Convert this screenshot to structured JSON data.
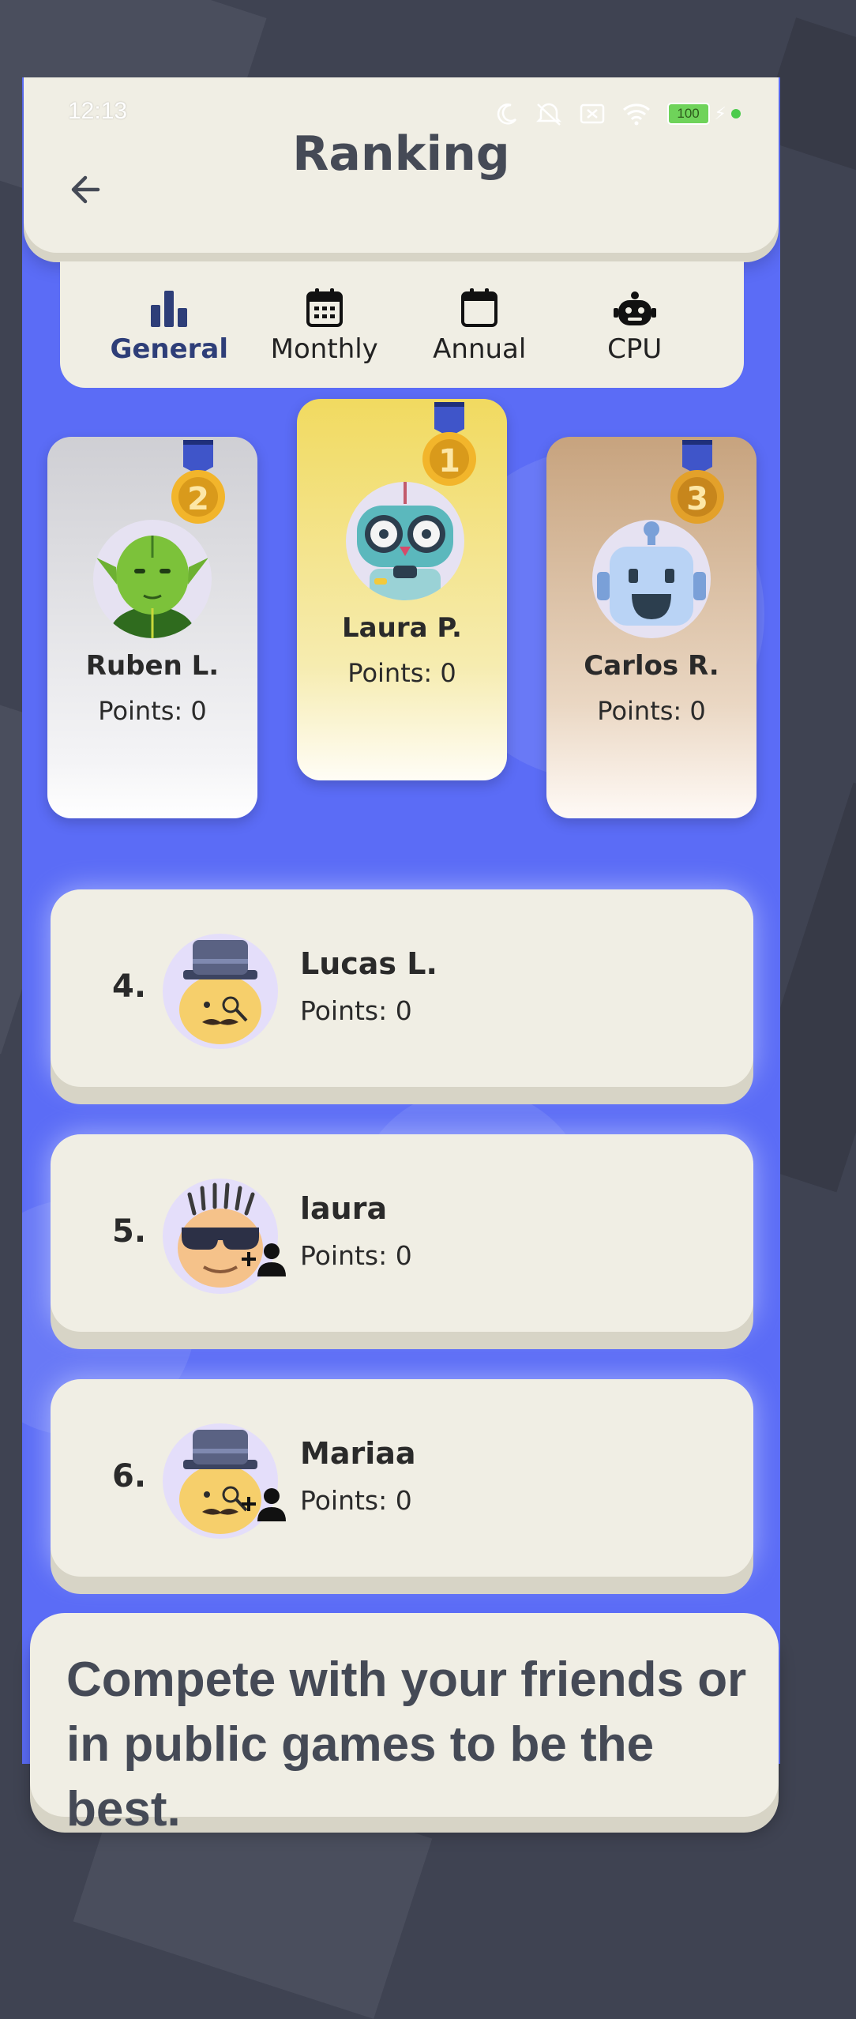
{
  "status_bar": {
    "time": "12:13",
    "battery": "100"
  },
  "header": {
    "title": "Ranking"
  },
  "tabs": [
    {
      "label": "General",
      "icon": "bar-chart-icon",
      "active": true
    },
    {
      "label": "Monthly",
      "icon": "calendar-grid-icon",
      "active": false
    },
    {
      "label": "Annual",
      "icon": "calendar-blank-icon",
      "active": false
    },
    {
      "label": "CPU",
      "icon": "robot-icon",
      "active": false
    }
  ],
  "podium": [
    {
      "place": "2",
      "name": "Ruben L.",
      "points": "Points: 0",
      "medal_color": "#f2b52b"
    },
    {
      "place": "1",
      "name": "Laura P.",
      "points": "Points: 0",
      "medal_color": "#f2b52b"
    },
    {
      "place": "3",
      "name": "Carlos R.",
      "points": "Points: 0",
      "medal_color": "#e3a12a"
    }
  ],
  "ranking": [
    {
      "rank": "4.",
      "name": "Lucas L.",
      "points": "Points: 0",
      "add_friend": false
    },
    {
      "rank": "5.",
      "name": "laura",
      "points": "Points: 0",
      "add_friend": true
    },
    {
      "rank": "6.",
      "name": "Mariaa",
      "points": "Points: 0",
      "add_friend": true
    }
  ],
  "banner": {
    "text": "Compete with your friends or in public games to be the best."
  },
  "colors": {
    "accent": "#5b6cf6",
    "card": "#f0eee4",
    "active_tab": "#2e3e78",
    "gold": "#f2b52b"
  }
}
